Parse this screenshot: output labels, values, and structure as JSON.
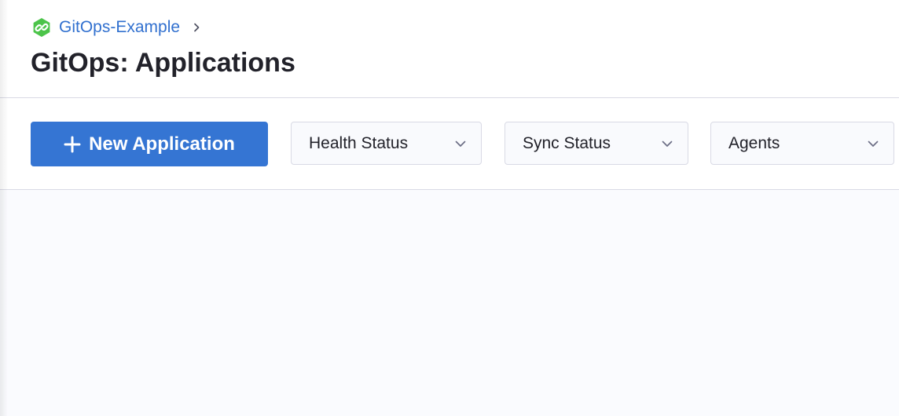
{
  "breadcrumb": {
    "project_name": "GitOps-Example",
    "project_icon": "hexagon-link-icon",
    "separator_icon": "chevron-right-icon"
  },
  "page": {
    "title": "GitOps: Applications"
  },
  "toolbar": {
    "new_application_label": "New Application",
    "new_application_icon": "plus-icon",
    "filters": {
      "health_status": "Health Status",
      "sync_status": "Sync Status",
      "agents": "Agents"
    },
    "dropdown_icon": "chevron-down-icon"
  },
  "colors": {
    "accent": "#3575d3",
    "link": "#3170cf",
    "project_icon_green": "#4cc44a",
    "title_text": "#22222a",
    "content_background": "#fafbfe",
    "border": "#d9dae5"
  }
}
